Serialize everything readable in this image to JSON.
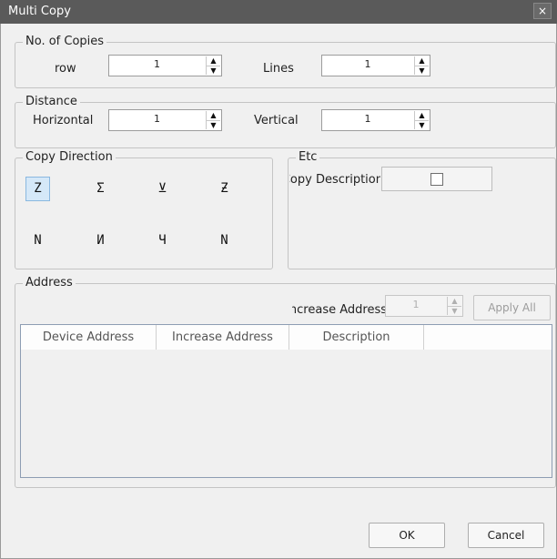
{
  "window": {
    "title": "Multi Copy",
    "close_glyph": "×"
  },
  "copies": {
    "group_label": "No. of Copies",
    "row_label": "row",
    "row_value": "1",
    "lines_label": "Lines",
    "lines_value": "1"
  },
  "distance": {
    "group_label": "Distance",
    "horizontal_label": "Horizontal",
    "horizontal_value": "1",
    "vertical_label": "Vertical",
    "vertical_value": "1"
  },
  "spin_glyphs": {
    "up": "▲",
    "down": "▼"
  },
  "direction": {
    "group_label": "Copy Direction",
    "items": [
      {
        "icon": "direction-1-icon",
        "glyph": "Z",
        "selected": true
      },
      {
        "icon": "direction-2-icon",
        "glyph": "Σ",
        "selected": false
      },
      {
        "icon": "direction-3-icon",
        "glyph": "⊻",
        "selected": false
      },
      {
        "icon": "direction-4-icon",
        "glyph": "Ƶ",
        "selected": false
      },
      {
        "icon": "direction-5-icon",
        "glyph": "N",
        "selected": false
      },
      {
        "icon": "direction-6-icon",
        "glyph": "И",
        "selected": false
      },
      {
        "icon": "direction-7-icon",
        "glyph": "Ч",
        "selected": false
      },
      {
        "icon": "direction-8-icon",
        "glyph": "Ν",
        "selected": false
      }
    ]
  },
  "etc": {
    "group_label": "Etc",
    "copy_description_label": "Copy Description",
    "checked": false
  },
  "address": {
    "group_label": "Address",
    "increase_label": "Increase Address",
    "increase_value": "1",
    "apply_all_label": "Apply All",
    "columns": [
      "Device Address",
      "Increase Address",
      "Description"
    ]
  },
  "footer": {
    "ok_label": "OK",
    "cancel_label": "Cancel"
  }
}
